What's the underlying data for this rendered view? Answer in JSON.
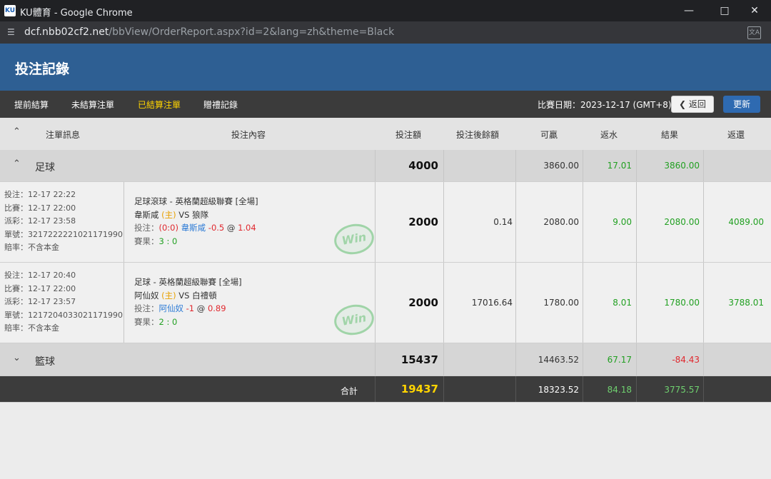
{
  "window": {
    "title": "KU體育 - Google Chrome",
    "logo_text": "KU",
    "url_host": "dcf.nbb02cf2.net",
    "url_path": "/bbView/OrderReport.aspx?id=2&lang=zh&theme=Black"
  },
  "header": {
    "title": "投注記錄"
  },
  "nav": {
    "tabs": [
      "提前結算",
      "未結算注單",
      "已結算注單",
      "贈禮記錄"
    ],
    "active_tab": "已結算注單",
    "date_label": "比賽日期：2023-12-17 (GMT+8)",
    "back_label": "返回",
    "refresh_label": "更新"
  },
  "table": {
    "columns": [
      "注單訊息",
      "投注內容",
      "投注額",
      "投注後餘額",
      "可贏",
      "返水",
      "結果",
      "返還"
    ],
    "groups": [
      {
        "sport": "足球",
        "stake": "4000",
        "can_win": "3860.00",
        "rebate": "17.01",
        "result": "3860.00",
        "bets": [
          {
            "info": [
              "投注：12-17 22:22",
              "比賽：12-17 22:00",
              "派彩：12-17 23:58",
              "單號：3217222221021171990",
              "賠率：不含本金"
            ],
            "league": "足球滾球 - 英格蘭超級聯賽 [全場]",
            "home": "韋斯咸",
            "home_tag": "(主)",
            "vs": "VS",
            "away": "狼隊",
            "bet_label": "投注：",
            "bet_score": "(0:0)",
            "bet_team": "韋斯咸",
            "bet_line": "-0.5",
            "bet_at": "@",
            "bet_odds": "1.04",
            "result_label": "賽果：",
            "result_score": "3 : 0",
            "win_badge": "Win",
            "stake": "2000",
            "balance": "0.14",
            "can_win": "2080.00",
            "rebate": "9.00",
            "result": "2080.00",
            "returned": "4089.00"
          },
          {
            "info": [
              "投注：12-17 20:40",
              "比賽：12-17 22:00",
              "派彩：12-17 23:57",
              "單號：1217204033021171990",
              "賠率：不含本金"
            ],
            "league": "足球 - 英格蘭超級聯賽 [全場]",
            "home": "阿仙奴",
            "home_tag": "(主)",
            "vs": "VS",
            "away": "白禮頓",
            "bet_label": "投注：",
            "bet_score": "",
            "bet_team": "阿仙奴",
            "bet_line": "-1",
            "bet_at": "@",
            "bet_odds": "0.89",
            "result_label": "賽果：",
            "result_score": "2 : 0",
            "win_badge": "Win",
            "stake": "2000",
            "balance": "17016.64",
            "can_win": "1780.00",
            "rebate": "8.01",
            "result": "1780.00",
            "returned": "3788.01"
          }
        ]
      },
      {
        "sport": "籃球",
        "stake": "15437",
        "can_win": "14463.52",
        "rebate": "67.17",
        "result": "-84.43"
      }
    ],
    "total": {
      "label": "合計",
      "stake": "19437",
      "can_win": "18323.52",
      "rebate": "84.18",
      "result": "3775.57"
    }
  }
}
